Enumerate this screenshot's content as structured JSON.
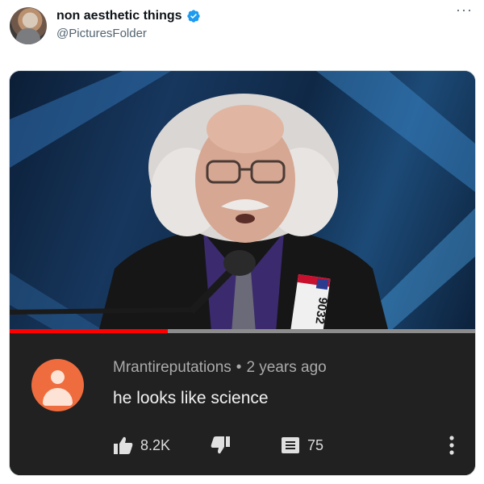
{
  "tweet": {
    "display_name": "non aesthetic things",
    "handle": "@PicturesFolder",
    "more_label": "···"
  },
  "video": {
    "badge_number": "9032",
    "progress_fraction": 0.34,
    "progress_color": "#ff0000"
  },
  "comment": {
    "author": "Mrantireputations",
    "separator": "•",
    "time": "2 years ago",
    "text": "he looks like science",
    "likes": "8.2K",
    "replies": "75"
  },
  "colors": {
    "verified": "#1d9bf0",
    "comment_bg": "#212121",
    "commenter_avatar": "#ef6c3e"
  },
  "icons": [
    "verified-badge-icon",
    "more-icon",
    "thumbs-up-icon",
    "thumbs-down-icon",
    "comment-icon",
    "kebab-menu-icon"
  ]
}
